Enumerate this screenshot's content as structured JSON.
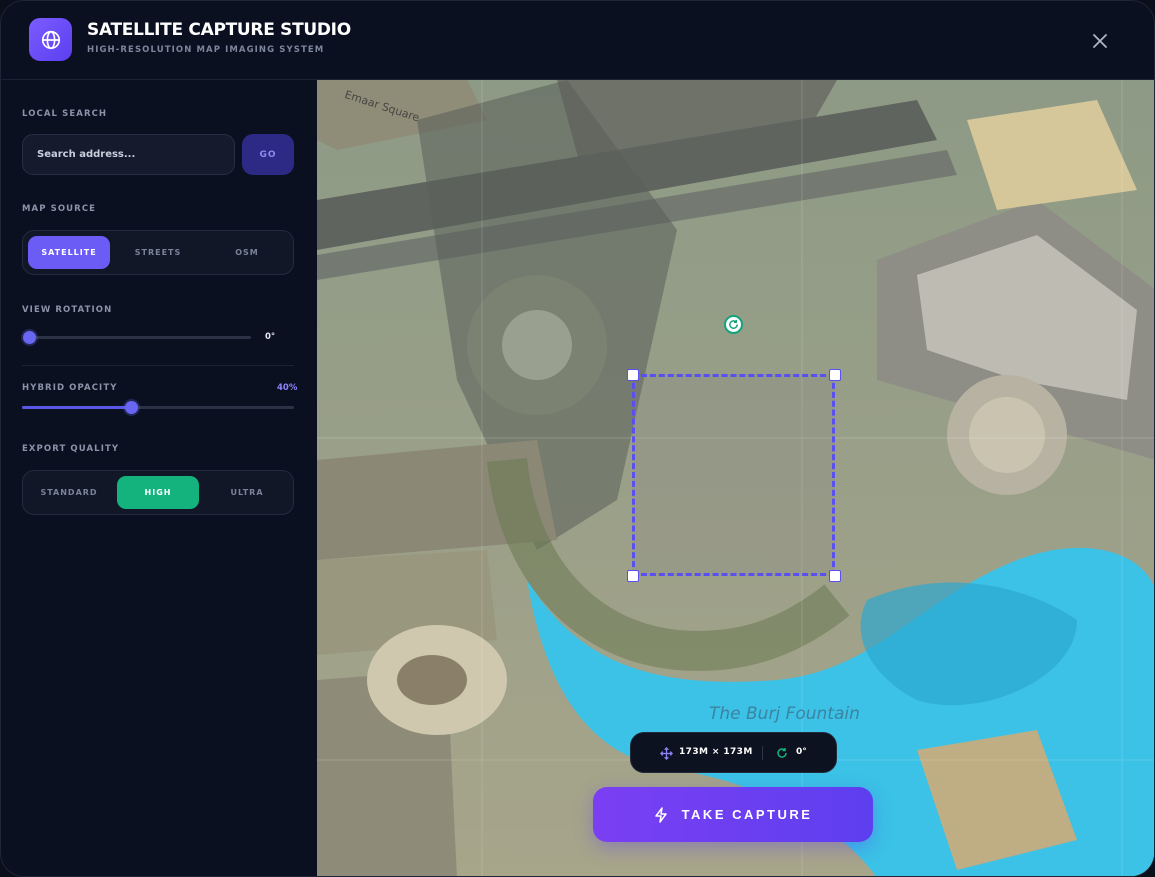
{
  "header": {
    "title": "SATELLITE CAPTURE STUDIO",
    "subtitle": "HIGH-RESOLUTION MAP IMAGING SYSTEM",
    "logo_icon": "globe-icon",
    "close_icon": "close-icon"
  },
  "sidebar": {
    "local_search": {
      "label": "LOCAL SEARCH",
      "placeholder": "Search address...",
      "value": "",
      "go_label": "GO"
    },
    "map_source": {
      "label": "MAP SOURCE",
      "options": [
        "SATELLITE",
        "STREETS",
        "OSM"
      ],
      "selected": "SATELLITE"
    },
    "view_rotation": {
      "label": "VIEW ROTATION",
      "value_text": "0°",
      "value": 0
    },
    "hybrid_opacity": {
      "label": "HYBRID OPACITY",
      "value_text": "40%",
      "value": 0.4
    },
    "export_quality": {
      "label": "EXPORT QUALITY",
      "options": [
        "STANDARD",
        "HIGH",
        "ULTRA"
      ],
      "selected": "HIGH"
    }
  },
  "map": {
    "street_label": "Emaar Square",
    "place_label": "The Burj Fountain",
    "selection": {
      "dimensions": "173M × 173M",
      "rotation": "0°"
    },
    "capture_label": "TAKE CAPTURE"
  },
  "colors": {
    "accent": "#6b5cf6",
    "success": "#14b37d",
    "background": "#0c1120"
  }
}
